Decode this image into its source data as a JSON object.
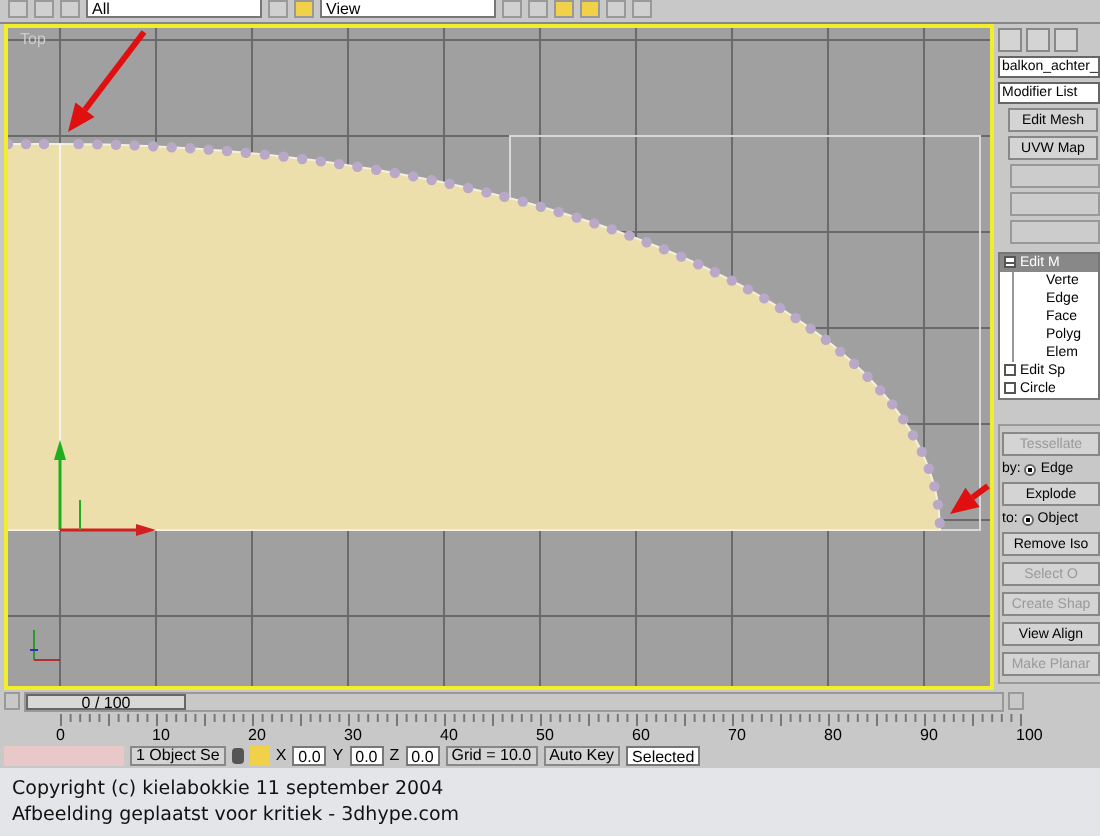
{
  "toolbar": {
    "selection_filter": "All",
    "reference_coord": "View",
    "tools": [
      {
        "on": false
      },
      {
        "on": false
      },
      {
        "on": false
      },
      {
        "on": false
      },
      {
        "on": true
      },
      {
        "on": false
      },
      {
        "on": false
      },
      {
        "on": true
      },
      {
        "on": true
      },
      {
        "on": false
      },
      {
        "on": false
      }
    ]
  },
  "viewport": {
    "label": "Top",
    "active": true
  },
  "command_panel": {
    "object_name": "balkon_achter_",
    "modifier_list": "Modifier List",
    "modifier_buttons": [
      "Edit Mesh",
      "UVW Map"
    ],
    "stack": [
      {
        "label": "Edit M",
        "expanded": true,
        "selected": true,
        "children": [
          {
            "label": "Verte"
          },
          {
            "label": "Edge"
          },
          {
            "label": "Face"
          },
          {
            "label": "Polyg"
          },
          {
            "label": "Elem"
          }
        ]
      },
      {
        "label": "Edit Sp",
        "expanded": false,
        "selected": false
      },
      {
        "label": "Circle",
        "expanded": false,
        "selected": false
      }
    ],
    "rollout": [
      {
        "kind": "button",
        "label": "Tessellate",
        "disabled": true
      },
      {
        "kind": "radio",
        "prefix": "by:",
        "label": "Edge",
        "selected": true
      },
      {
        "kind": "button",
        "label": "Explode",
        "disabled": false
      },
      {
        "kind": "radio",
        "prefix": "to:",
        "label": "Object",
        "selected": true
      },
      {
        "kind": "button",
        "label": "Remove Iso",
        "disabled": false
      },
      {
        "kind": "button",
        "label": "Select O",
        "disabled": true
      },
      {
        "kind": "button",
        "label": "Create Shap",
        "disabled": true
      },
      {
        "kind": "button",
        "label": "View Align",
        "disabled": false
      },
      {
        "kind": "button",
        "label": "Make Planar",
        "disabled": true
      }
    ]
  },
  "time_slider": {
    "label": "0 / 100",
    "level": 0
  },
  "ruler": {
    "ticks": [
      "0",
      "10",
      "20",
      "30",
      "40",
      "50",
      "60",
      "70",
      "80",
      "90",
      "100"
    ]
  },
  "status_bar": {
    "selection": "1 Object Se",
    "coordinates": [
      {
        "axis": "X",
        "value": "0.0"
      },
      {
        "axis": "Y",
        "value": "0.0"
      },
      {
        "axis": "Z",
        "value": "0.0"
      }
    ],
    "grid": "Grid = 10.0",
    "auto_key": "Auto Key",
    "key_filter": "Selected"
  },
  "caption": [
    "Copyright (c) kielabokkie 11 september 2004",
    "Afbeelding geplaatst voor kritiek - 3dhype.com"
  ]
}
